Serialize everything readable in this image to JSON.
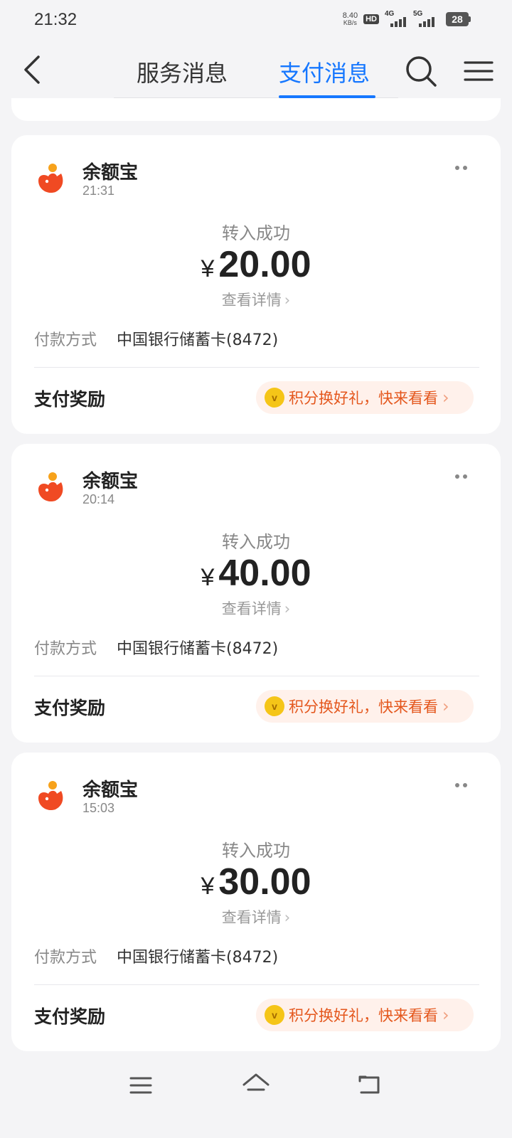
{
  "status_bar": {
    "time": "21:32",
    "net_speed": "8.40",
    "net_unit": "KB/s",
    "hd": "HD",
    "signal1": "4G",
    "signal2": "5G",
    "battery": "28"
  },
  "nav": {
    "tabs": [
      {
        "label": "服务消息",
        "active": false
      },
      {
        "label": "支付消息",
        "active": true
      }
    ],
    "accent": "#1677ff"
  },
  "messages": [
    {
      "merchant": "余额宝",
      "time": "21:31",
      "status": "转入成功",
      "currency": "¥",
      "amount": "20.00",
      "details_link": "查看详情",
      "pay_method_label": "付款方式",
      "pay_method": "中国银行储蓄卡(8472)",
      "reward_label": "支付奖励",
      "reward_text": "积分换好礼，快来看看"
    },
    {
      "merchant": "余额宝",
      "time": "20:14",
      "status": "转入成功",
      "currency": "¥",
      "amount": "40.00",
      "details_link": "查看详情",
      "pay_method_label": "付款方式",
      "pay_method": "中国银行储蓄卡(8472)",
      "reward_label": "支付奖励",
      "reward_text": "积分换好礼，快来看看"
    },
    {
      "merchant": "余额宝",
      "time": "15:03",
      "status": "转入成功",
      "currency": "¥",
      "amount": "30.00",
      "details_link": "查看详情",
      "pay_method_label": "付款方式",
      "pay_method": "中国银行储蓄卡(8472)",
      "reward_label": "支付奖励",
      "reward_text": "积分换好礼，快来看看"
    }
  ],
  "icons": {
    "back": "back-icon",
    "search": "search-icon",
    "menu": "menu-icon",
    "logo": "yuebao-logo-icon",
    "more": "more-icon",
    "coin": "coin-icon",
    "nav_menu": "nav-menu-icon",
    "nav_home": "nav-home-icon",
    "nav_back": "nav-back-icon"
  },
  "colors": {
    "background": "#f4f4f6",
    "reward_text": "#e4571d",
    "reward_bg": "#fff1eb",
    "logo": "#f04a23"
  }
}
